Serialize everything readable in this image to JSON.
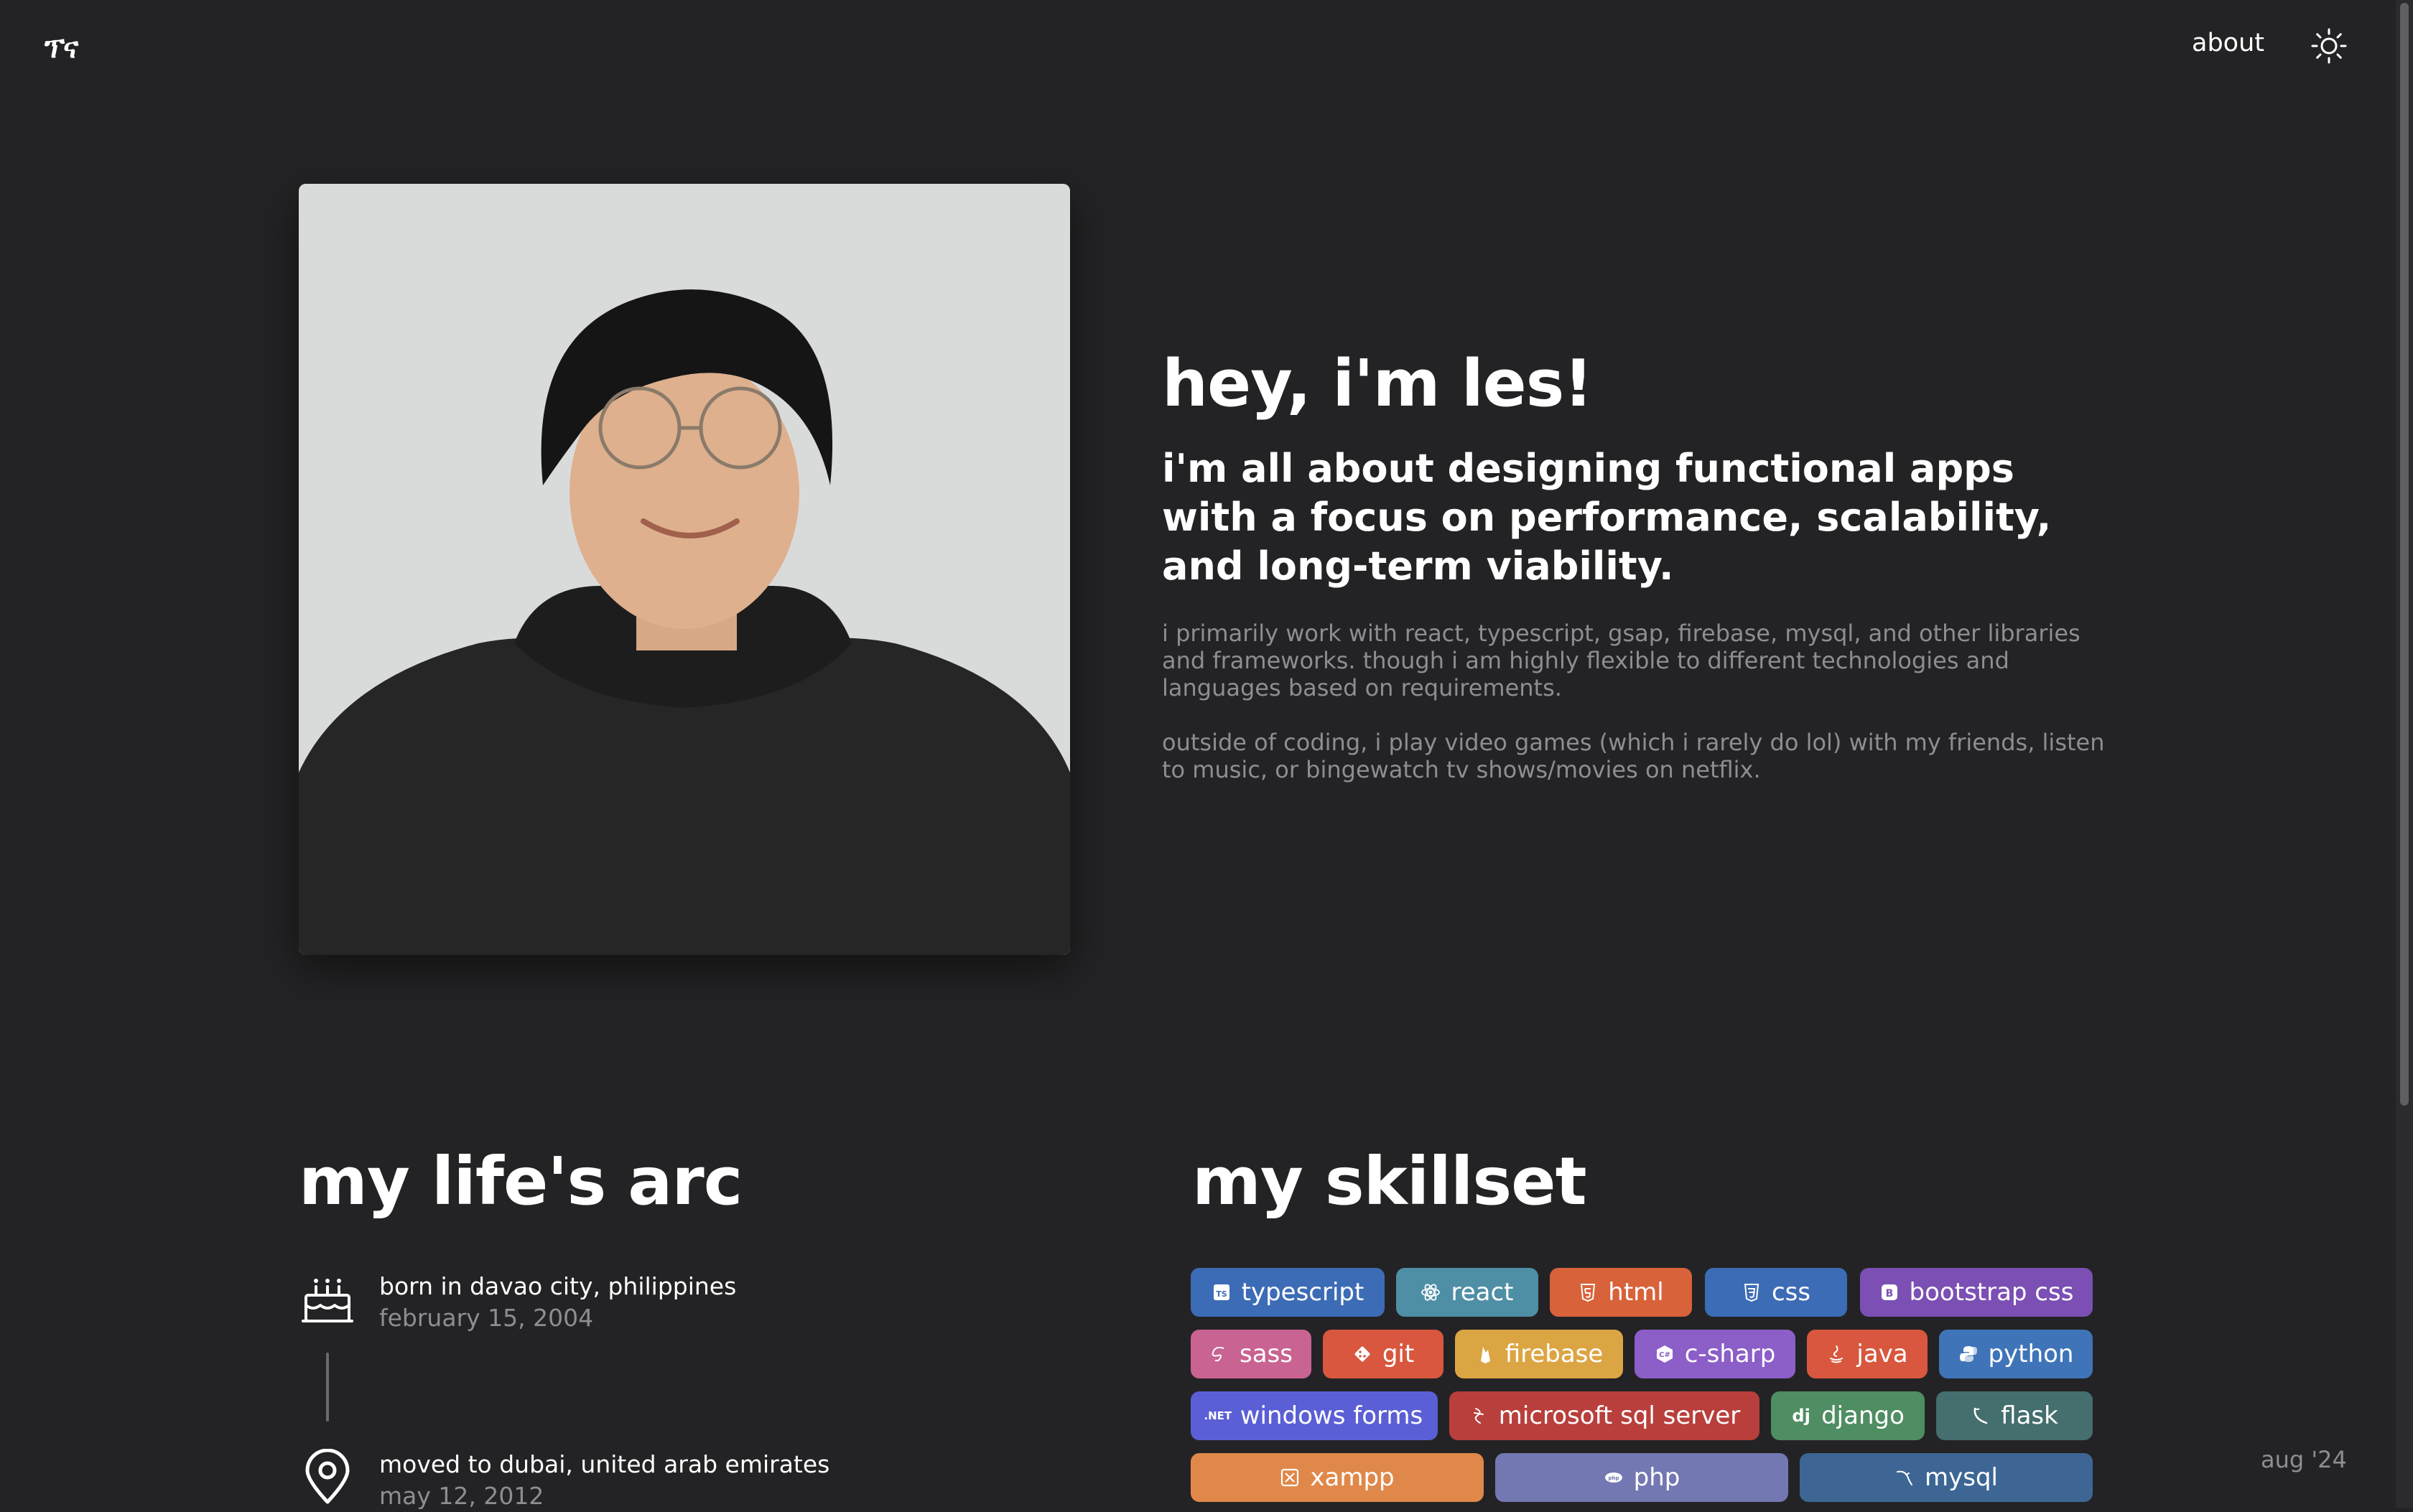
{
  "header": {
    "logo": "ፕና",
    "nav_about": "about",
    "theme_toggle_icon": "sun-icon"
  },
  "intro": {
    "greeting": "hey, i'm les!",
    "tagline": "i'm all about designing functional apps with a focus on performance, scalability, and long-term viability.",
    "bio_1": "i primarily work with react, typescript, gsap, firebase, mysql, and other libraries and frameworks. though i am highly flexible to different technologies and languages based on requirements.",
    "bio_2": "outside of coding, i play video games (which i rarely do lol) with my friends, listen to music, or bingewatch tv shows/movies on netflix."
  },
  "life_arc": {
    "title": "my life's arc",
    "items": [
      {
        "icon": "birthday-cake-icon",
        "label": "born in davao city, philippines",
        "date": "february 15, 2004"
      },
      {
        "icon": "map-pin-icon",
        "label": "moved to dubai, united arab emirates",
        "date": "may 12, 2012"
      }
    ]
  },
  "skillset": {
    "title": "my skillset",
    "skills": [
      {
        "label": "typescript",
        "icon": "typescript-icon",
        "color": "#3d6cb6"
      },
      {
        "label": "react",
        "icon": "react-icon",
        "color": "#4f8fa6"
      },
      {
        "label": "html",
        "icon": "html5-icon",
        "color": "#d8623a"
      },
      {
        "label": "css",
        "icon": "css3-icon",
        "color": "#3d6cb6"
      },
      {
        "label": "bootstrap css",
        "icon": "bootstrap-icon",
        "color": "#7b4fb3"
      },
      {
        "label": "sass",
        "icon": "sass-icon",
        "color": "#c96391"
      },
      {
        "label": "git",
        "icon": "git-icon",
        "color": "#d8573e"
      },
      {
        "label": "firebase",
        "icon": "firebase-icon",
        "color": "#dca543"
      },
      {
        "label": "c-sharp",
        "icon": "csharp-icon",
        "color": "#8c5ec8"
      },
      {
        "label": "java",
        "icon": "java-icon",
        "color": "#d8573e"
      },
      {
        "label": "python",
        "icon": "python-icon",
        "color": "#3f74b8"
      },
      {
        "label": "windows forms",
        "icon": "dotnet-icon",
        "color": "#5b5fd6"
      },
      {
        "label": "microsoft sql server",
        "icon": "sql-server-icon",
        "color": "#b83f3c"
      },
      {
        "label": "django",
        "icon": "django-icon",
        "color": "#4f8d62"
      },
      {
        "label": "flask",
        "icon": "flask-icon",
        "color": "#456e6e"
      },
      {
        "label": "xampp",
        "icon": "xampp-icon",
        "color": "#e0884a"
      },
      {
        "label": "php",
        "icon": "php-icon",
        "color": "#7378b3"
      },
      {
        "label": "mysql",
        "icon": "mysql-icon",
        "color": "#3d6694"
      }
    ]
  },
  "footer": {
    "date": "aug '24"
  }
}
